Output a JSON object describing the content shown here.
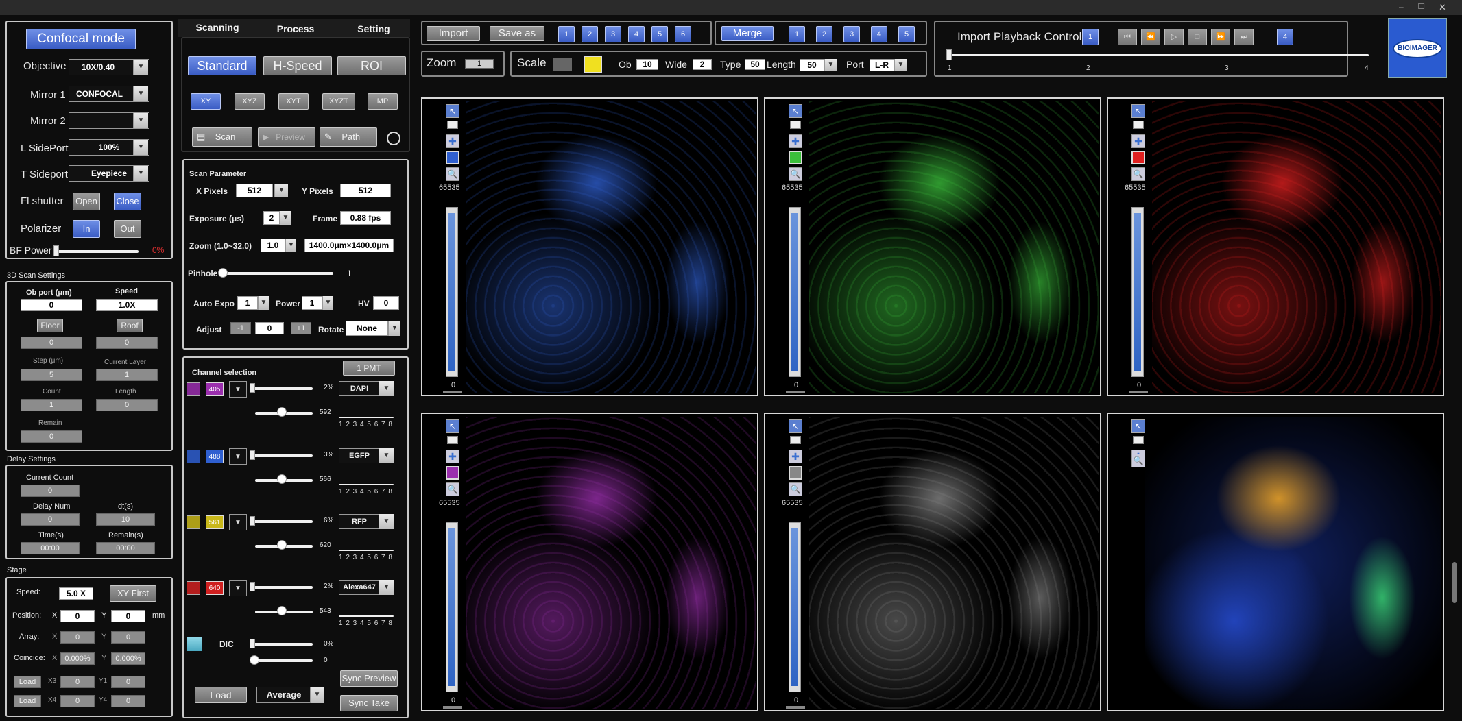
{
  "left": {
    "confocal_btn": "Confocal mode",
    "objective": {
      "label": "Objective",
      "value": "10X/0.40"
    },
    "mirror1": {
      "label": "Mirror 1",
      "value": "CONFOCAL"
    },
    "mirror2": {
      "label": "Mirror 2",
      "value": ""
    },
    "lsideport": {
      "label": "L SidePort",
      "value": "100%"
    },
    "tsideport": {
      "label": "T Sideport",
      "value": "Eyepiece"
    },
    "flshutter": {
      "label": "Fl shutter",
      "open": "Open",
      "close": "Close"
    },
    "polarizer": {
      "label": "Polarizer",
      "in": "In",
      "out": "Out"
    },
    "bfpower": {
      "label": "BF Power",
      "value": "0%",
      "level": 0
    },
    "scan3d": {
      "title": "3D Scan Settings",
      "obport": "Ob port (μm)",
      "obport_val": "0",
      "speed": "Speed",
      "speed_val": "1.0X",
      "floor": "Floor",
      "roof": "Roof",
      "floor_val": "0",
      "roof_val": "0",
      "step": "Step (μm)",
      "step_val": "5",
      "curlayer": "Current Layer",
      "curlayer_val": "1",
      "count": "Count",
      "count_val": "1",
      "length": "Length",
      "length_val": "0",
      "remain": "Remain",
      "remain_val": "0"
    },
    "delay": {
      "title": "Delay Settings",
      "curcount": "Current Count",
      "curcount_val": "0",
      "delaynum": "Delay Num",
      "delaynum_val": "0",
      "dt": "dt(s)",
      "dt_val": "10",
      "time": "Time(s)",
      "time_val": "00:00",
      "remain": "Remain(s)",
      "remain_val": "00:00"
    },
    "stage": {
      "title": "Stage",
      "speed": "Speed:",
      "speed_val": "5.0 X",
      "xyfirst": "XY First",
      "position": "Position:",
      "x": "X",
      "x_val": "0",
      "y": "Y",
      "y_val": "0",
      "mm": "mm",
      "array": "Array:",
      "ax": "X",
      "ax_val": "0",
      "ay": "Y",
      "ay_val": "0",
      "coincide": "Coincide:",
      "cx": "X",
      "cx_val": "0.000%",
      "cy": "Y",
      "cy_val": "0.000%",
      "load1": "Load",
      "x3": "X3",
      "x3_val": "0",
      "y1": "Y1",
      "y1_val": "0",
      "load2": "Load",
      "x4": "X4",
      "x4_val": "0",
      "y4": "Y4",
      "y4_val": "0"
    }
  },
  "mid": {
    "tabs": [
      "Scanning",
      "Process",
      "Setting"
    ],
    "modes": [
      "Standard",
      "H-Speed",
      "ROI"
    ],
    "scanmodes": [
      "XY",
      "XYZ",
      "XYT",
      "XYZT",
      "MP"
    ],
    "scan": "Scan",
    "preview": "Preview",
    "path": "Path",
    "param": {
      "title": "Scan Parameter",
      "xpix": "X Pixels",
      "xpix_val": "512",
      "ypix": "Y Pixels",
      "ypix_val": "512",
      "exposure": "Exposure (μs)",
      "exposure_val": "2",
      "frame": "Frame",
      "frame_val": "0.88 fps",
      "zoom": "Zoom (1.0~32.0)",
      "zoom_val": "1.0",
      "fov": "1400.0μm×1400.0μm",
      "pinhole": "Pinhole",
      "pinhole_val": "1",
      "autoexpo": "Auto Expo",
      "autoexpo_val": "1",
      "power": "Power",
      "power_val": "1",
      "hv": "HV",
      "hv_val": "0",
      "adjust": "Adjust",
      "adj_minus": "-1",
      "adj_val": "0",
      "adj_plus": "+1",
      "rotate": "Rotate",
      "rotate_val": "None"
    },
    "channels": {
      "title": "Channel selection",
      "pmt": "1 PMT",
      "list": [
        {
          "wl": "405",
          "color": "#9b2fae",
          "pct": "2%",
          "name": "DAPI",
          "sub": "592"
        },
        {
          "wl": "488",
          "color": "#2f5fd0",
          "pct": "3%",
          "name": "EGFP",
          "sub": "566"
        },
        {
          "wl": "561",
          "color": "#c9b81a",
          "pct": "6%",
          "name": "RFP",
          "sub": "620"
        },
        {
          "wl": "640",
          "color": "#d02020",
          "pct": "2%",
          "name": "Alexa647",
          "sub": "543"
        }
      ],
      "dic": "DIC",
      "dic_pct": "0%",
      "dic_sub": "0",
      "ticks": "1 2 3 4 5 6 7 8",
      "load": "Load",
      "average": "Average",
      "syncpreview": "Sync Preview",
      "synctake": "Sync Take"
    }
  },
  "top": {
    "import": "Import",
    "saveas": "Save as",
    "nums1": [
      "1",
      "2",
      "3",
      "4",
      "5",
      "6"
    ],
    "merge": "Merge",
    "nums2": [
      "1",
      "2",
      "3",
      "4",
      "5"
    ],
    "zoom": "Zoom",
    "zoom_val": "1",
    "scale": "Scale",
    "ob": "Ob",
    "ob_val": "10",
    "wide": "Wide",
    "wide_val": "2",
    "type": "Type",
    "type_val": "50",
    "length": "Length",
    "length_val": "50",
    "port": "Port",
    "port_val": "L-R",
    "playback": "Import Playback Control",
    "pb_num": "1",
    "pb_num2": "4",
    "pb_ticks": [
      "1",
      "2",
      "3",
      "4"
    ],
    "logo": "BIOIMAGER"
  },
  "views": [
    {
      "max": "65535",
      "min": "0",
      "color": "#2f5fd0"
    },
    {
      "max": "65535",
      "min": "0",
      "color": "#3bbf3b"
    },
    {
      "max": "65535",
      "min": "0",
      "color": "#e02020"
    },
    {
      "max": "65535",
      "min": "0",
      "color": "#9b2fae"
    },
    {
      "max": "65535",
      "min": "0",
      "color": "#888888"
    },
    {
      "max": "",
      "min": "",
      "color": ""
    }
  ]
}
